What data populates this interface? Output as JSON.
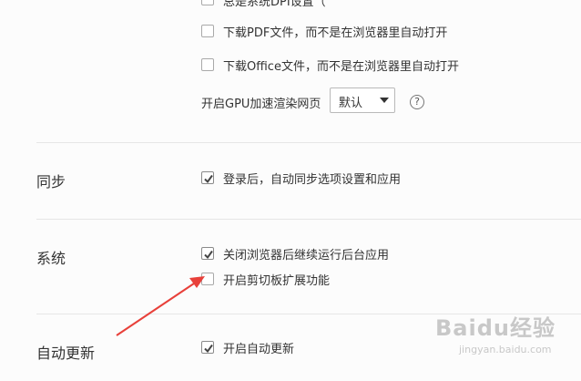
{
  "advanced": {
    "row0_label": "总是系统DPI设置（",
    "download_pdf_label": "下载PDF文件，而不是在浏览器里自动打开",
    "download_office_label": "下载Office文件，而不是在浏览器里自动打开",
    "gpu_label": "开启GPU加速渲染网页",
    "gpu_select_value": "默认",
    "help_glyph": "?"
  },
  "sync": {
    "title": "同步",
    "option_label": "登录后，自动同步选项设置和应用",
    "option_checked": true
  },
  "system": {
    "title": "系统",
    "option1_label": "关闭浏览器后继续运行后台应用",
    "option1_checked": true,
    "option2_label": "开启剪切板扩展功能",
    "option2_checked": false
  },
  "update": {
    "title": "自动更新",
    "option_label": "开启自动更新",
    "option_checked": true
  },
  "watermark": {
    "brand": "Baidu经验",
    "url": "jingyan.baidu.com"
  },
  "colors": {
    "arrow": "#e8403a",
    "background": "#fcfcfc"
  },
  "icons": {
    "check": "check-icon",
    "help": "question-circle-icon",
    "caret": "chevron-down-icon",
    "arrow": "red-arrow-annotation"
  }
}
